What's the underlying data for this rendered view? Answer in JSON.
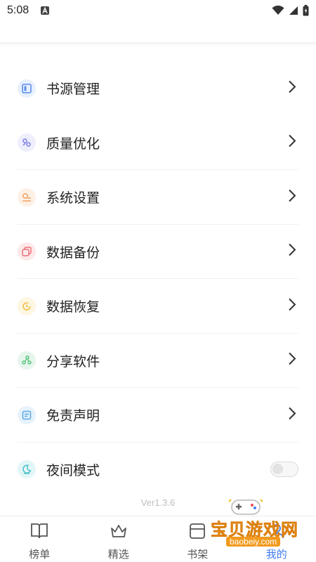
{
  "status_bar": {
    "time": "5:08"
  },
  "menu": {
    "items": [
      {
        "label": "书源管理",
        "icon": "book-source-icon",
        "color": "#5b8def",
        "bg": "#e8f0fe"
      },
      {
        "label": "质量优化",
        "icon": "quality-icon",
        "color": "#7a7de8",
        "bg": "#eeeefd"
      },
      {
        "label": "系统设置",
        "icon": "settings-icon",
        "color": "#f0a060",
        "bg": "#fdf1e6"
      },
      {
        "label": "数据备份",
        "icon": "backup-icon",
        "color": "#ef6f79",
        "bg": "#fde9ea"
      },
      {
        "label": "数据恢复",
        "icon": "restore-icon",
        "color": "#f1c24a",
        "bg": "#fdf6e1"
      },
      {
        "label": "分享软件",
        "icon": "share-icon",
        "color": "#53c077",
        "bg": "#e6f6ec"
      },
      {
        "label": "免责声明",
        "icon": "disclaimer-icon",
        "color": "#58a8e6",
        "bg": "#e6f2fc"
      }
    ],
    "night_mode": {
      "label": "夜间模式",
      "icon": "night-mode-icon",
      "color": "#4fc1c9",
      "bg": "#e3f6f7",
      "enabled": false
    }
  },
  "version": "Ver1.3.6",
  "tabs": [
    {
      "label": "榜单",
      "icon": "book-icon",
      "active": false
    },
    {
      "label": "精选",
      "icon": "crown-icon",
      "active": false
    },
    {
      "label": "书架",
      "icon": "bookshelf-icon",
      "active": false
    },
    {
      "label": "我的",
      "icon": "profile-icon",
      "active": true
    }
  ],
  "watermark": {
    "title": "宝贝游戏网",
    "url": "baobeiy.com"
  },
  "colors": {
    "accent": "#3f7cf6",
    "watermark": "#f29a1e"
  }
}
